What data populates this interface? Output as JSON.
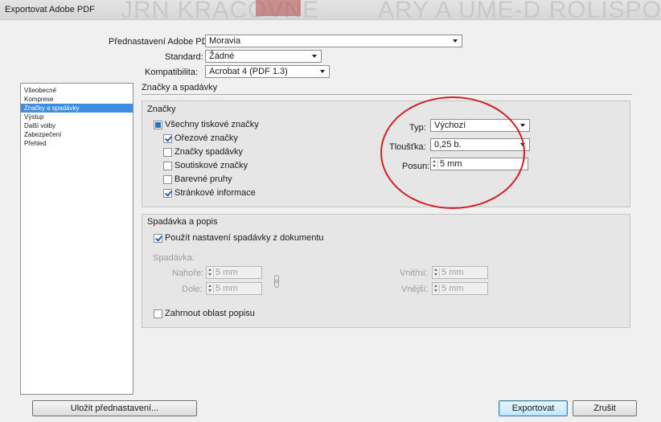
{
  "window": {
    "title": "Exportovat Adobe PDF",
    "ghost_left": "JRN KRÁCOVNE",
    "ghost_right": "ARY A UMĚ-D ROLISPOKOIN"
  },
  "top": {
    "preset_label": "Přednastavení Adobe PDF:",
    "preset_value": "Moravia",
    "standard_label": "Standard:",
    "standard_value": "Žádné",
    "compat_label": "Kompatibilita:",
    "compat_value": "Acrobat 4 (PDF 1.3)"
  },
  "sidebar": {
    "items": [
      {
        "label": "Všeobecné",
        "active": false
      },
      {
        "label": "Komprese",
        "active": false
      },
      {
        "label": "Značky a spadávky",
        "active": true
      },
      {
        "label": "Výstup",
        "active": false
      },
      {
        "label": "Další volby",
        "active": false
      },
      {
        "label": "Zabezpečení",
        "active": false
      },
      {
        "label": "Přehled",
        "active": false
      }
    ]
  },
  "section_title": "Značky a spadávky",
  "marks": {
    "title": "Značky",
    "all_marks": "Všechny tiskové značky",
    "crop_marks": "Ořezové značky",
    "bleed_marks": "Značky spadávky",
    "registration_marks": "Soutiskové značky",
    "color_bars": "Barevné pruhy",
    "page_info": "Stránkové informace",
    "type_label": "Typ:",
    "type_value": "Výchozí",
    "weight_label": "Tloušťka:",
    "weight_value": "0,25 b.",
    "offset_label": "Posun:",
    "offset_value": "5 mm"
  },
  "bleed": {
    "title": "Spadávka a popis",
    "use_doc": "Použít nastavení spadávky z dokumentu",
    "bleed_label": "Spadávka:",
    "top_label": "Nahoře:",
    "top_value": "5 mm",
    "bottom_label": "Dole:",
    "bottom_value": "5 mm",
    "inside_label": "Vnitřní:",
    "inside_value": "5 mm",
    "outside_label": "Vnější:",
    "outside_value": "5 mm",
    "include_slug": "Zahrnout oblast popisu"
  },
  "buttons": {
    "save_preset": "Uložit přednastavení...",
    "export": "Exportovat",
    "cancel": "Zrušit"
  },
  "colors": {
    "accent": "#3d8ee0",
    "annotation": "#d21f26"
  }
}
